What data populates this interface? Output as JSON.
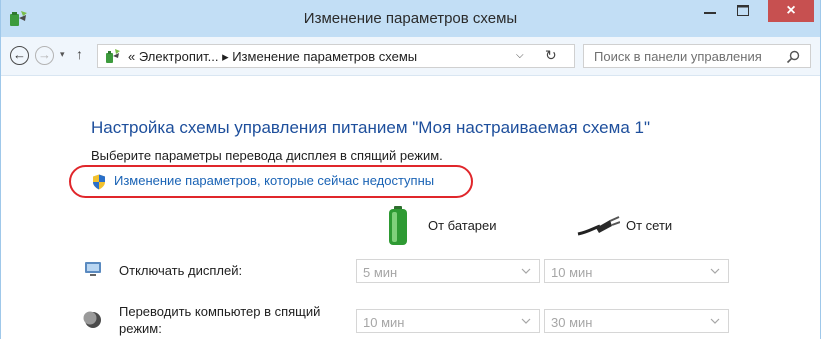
{
  "window": {
    "title": "Изменение параметров схемы",
    "close_glyph": "×"
  },
  "nav": {
    "back_glyph": "←",
    "forward_glyph": "→",
    "recent_glyph": "▾",
    "up_glyph": "↑",
    "address_text": "« Электропит... ▸ Изменение параметров схемы",
    "dropdown_glyph": "⌵",
    "refresh_glyph": "↻",
    "search_placeholder": "Поиск в панели управления"
  },
  "content": {
    "heading": "Настройка схемы управления питанием \"Моя настраиваемая схема 1\"",
    "subtext": "Выберите параметры перевода дисплея в спящий режим.",
    "change_link": "Изменение параметров, которые сейчас недоступны",
    "columns": {
      "battery": "От батареи",
      "ac": "От сети"
    },
    "rows": [
      {
        "label": "Отключать дисплей:",
        "battery_value": "5 мин",
        "ac_value": "10 мин"
      },
      {
        "label": "Переводить компьютер в спящий режим:",
        "battery_value": "10 мин",
        "ac_value": "30 мин"
      }
    ]
  },
  "colors": {
    "titlebar": "#c2def5",
    "close_button": "#c75050",
    "heading": "#1e4f9c",
    "link": "#1a63b5",
    "highlight": "#e0262b"
  },
  "icons": {
    "app": "power-options-icon",
    "address": "power-options-icon",
    "search": "search-icon",
    "shield": "uac-shield-icon",
    "battery": "battery-icon",
    "ac": "power-plug-icon",
    "display": "display-icon",
    "sleep": "sleep-moon-icon"
  }
}
